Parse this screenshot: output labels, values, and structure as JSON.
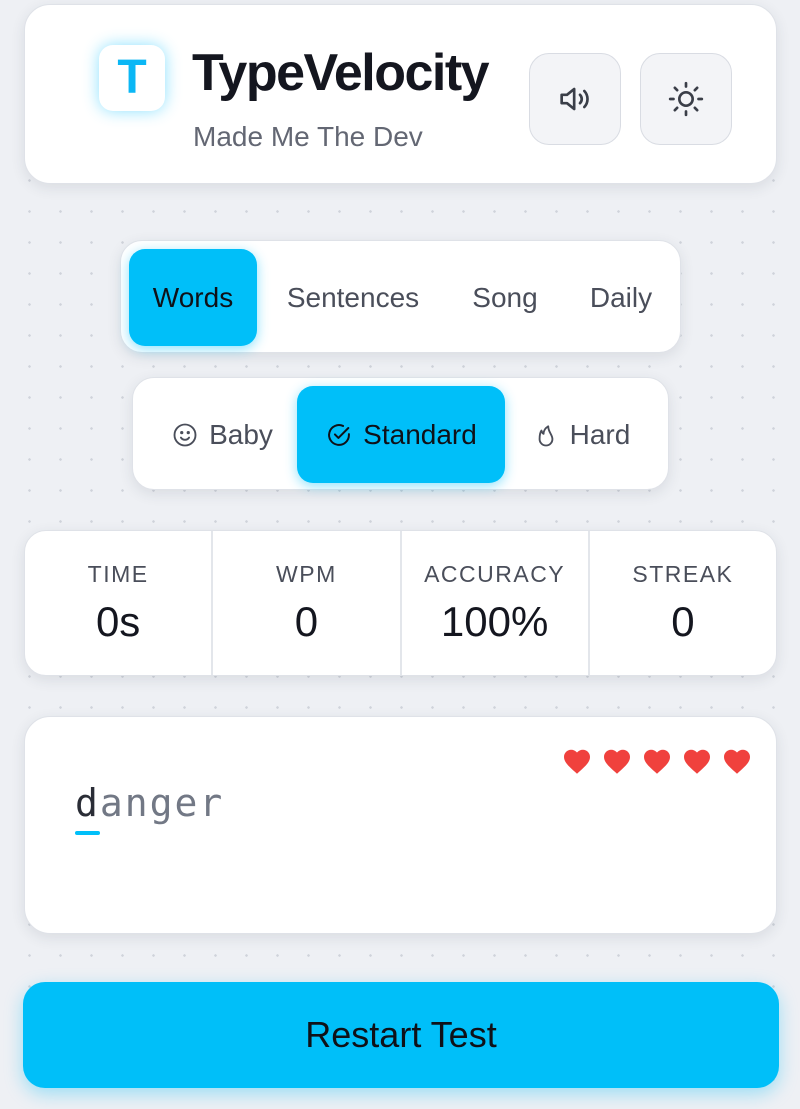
{
  "header": {
    "logo_letter": "T",
    "title": "TypeVelocity",
    "subtitle": "Made Me The Dev",
    "sound_icon": "speaker-icon",
    "theme_icon": "sun-icon"
  },
  "modes": {
    "items": [
      {
        "label": "Words",
        "active": true
      },
      {
        "label": "Sentences",
        "active": false
      },
      {
        "label": "Song",
        "active": false
      },
      {
        "label": "Daily",
        "active": false
      }
    ]
  },
  "difficulty": {
    "items": [
      {
        "label": "Baby",
        "icon": "smiley-icon",
        "active": false
      },
      {
        "label": "Standard",
        "icon": "check-circle-icon",
        "active": true
      },
      {
        "label": "Hard",
        "icon": "flame-icon",
        "active": false
      }
    ]
  },
  "stats": [
    {
      "label": "TIME",
      "value": "0s"
    },
    {
      "label": "WPM",
      "value": "0"
    },
    {
      "label": "ACCURACY",
      "value": "100%"
    },
    {
      "label": "STREAK",
      "value": "0"
    }
  ],
  "typing": {
    "lives": 5,
    "word_first": "d",
    "word_rest": "anger"
  },
  "restart_label": "Restart Test",
  "colors": {
    "accent": "#00bff9",
    "heart": "#f0413d",
    "background": "#eef0f4"
  }
}
